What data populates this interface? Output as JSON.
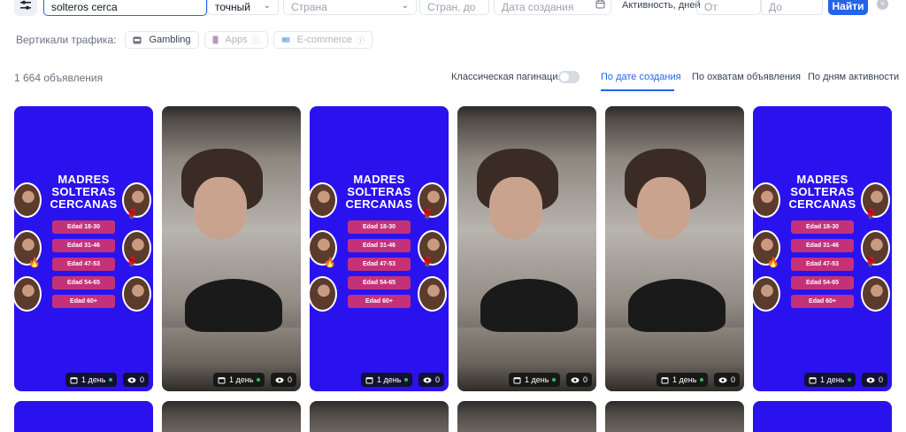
{
  "filters": {
    "search_value": "solteros cerca",
    "match_mode": "точный",
    "country_placeholder": "Страна",
    "countries_placeholder": "Стран, до",
    "date_placeholder": "Дата создания",
    "activity_label": "Активность, дней",
    "from_placeholder": "От",
    "to_placeholder": "До",
    "find_label": "Найти",
    "clear_label": "×"
  },
  "verticals": {
    "label": "Вертикали трафика:",
    "items": [
      {
        "label": "Gambling",
        "active": true
      },
      {
        "label": "Apps",
        "active": false
      },
      {
        "label": "E-commerce",
        "active": false
      }
    ]
  },
  "results": {
    "count_label": "1 664 объявления",
    "pagination_label": "Классическая пагинация",
    "pagination_enabled": false,
    "sort_tabs": [
      {
        "label": "По дате создания",
        "active": true
      },
      {
        "label": "По охватам объявления",
        "active": false
      },
      {
        "label": "По дням активности",
        "active": false
      }
    ]
  },
  "ad_creative": {
    "title_lines": [
      "MADRES",
      "SOLTERAS",
      "CERCANAS"
    ],
    "age_pills": [
      "Edad 18-30",
      "Edad 31-46",
      "Edad 47-53",
      "Edad 54-65",
      "Edad 60+"
    ]
  },
  "cards": [
    {
      "kind": "ad",
      "days": "1 день",
      "views": "0"
    },
    {
      "kind": "photo",
      "days": "1 день",
      "views": "0"
    },
    {
      "kind": "ad",
      "days": "1 день",
      "views": "0"
    },
    {
      "kind": "photo",
      "days": "1 день",
      "views": "0"
    },
    {
      "kind": "photo",
      "days": "1 день",
      "views": "0"
    },
    {
      "kind": "ad",
      "days": "1 день",
      "views": "0"
    }
  ],
  "colors": {
    "accent": "#2563eb",
    "ad_background": "#2a12ee",
    "age_pill": "#c4317a",
    "active_dot": "#22c55e"
  }
}
